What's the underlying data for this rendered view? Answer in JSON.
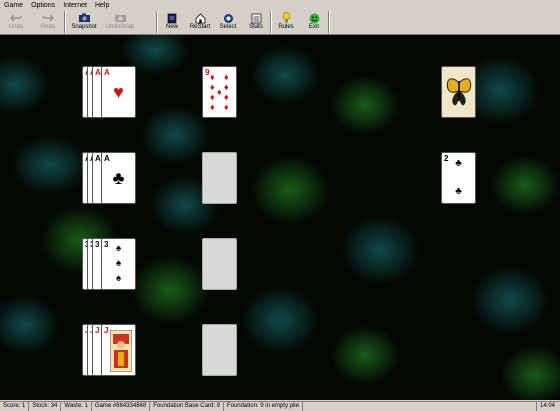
{
  "menu": [
    "Game",
    "Options",
    "Internet",
    "Help"
  ],
  "toolbar": {
    "undo": "Undo",
    "redo": "Redo",
    "snapshot": "Snapshot",
    "undosnap": "UndoSnap",
    "new": "New",
    "restart": "ReStart",
    "select": "Select",
    "stats": "Stats",
    "rules": "Rules",
    "exit": "Exit"
  },
  "cards": {
    "ah_rank": "A",
    "nine_d_rank": "9",
    "ac_rank": "A",
    "two_c_rank": "2",
    "three_s_rank": "3",
    "jh_rank": "J"
  },
  "status": {
    "score": "Score: 1",
    "stock": "Stock: 34",
    "waste": "Waste: 1",
    "game": "Game #884334848",
    "base": "Foundation Base Card: 9",
    "foundation": "Foundation: 9 in empty pile",
    "clock": "14:04"
  },
  "colors": {
    "felt": "#030803",
    "teal": "#1b7f82",
    "green": "#2aa12a",
    "red_suit": "#d01010"
  }
}
